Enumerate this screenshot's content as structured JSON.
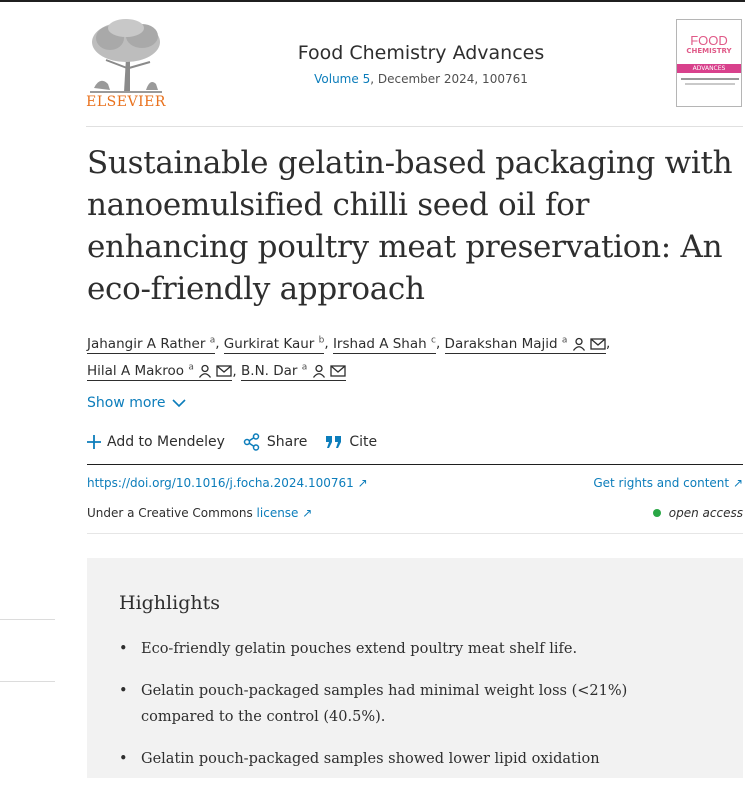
{
  "publisher": {
    "logo_text": "ELSEVIER"
  },
  "journal": {
    "name": "Food Chemistry Advances",
    "volume_link": "Volume 5",
    "issue_info": ", December 2024, 100761",
    "cover_line1": "FOOD",
    "cover_line2": "CHEMISTRY",
    "cover_band": "ADVANCES"
  },
  "article": {
    "title": "Sustainable gelatin-based packaging with nanoemulsified chilli seed oil for enhancing poultry meat preservation: An eco-friendly approach",
    "authors": [
      {
        "name": "Jahangir A Rather",
        "sup": "a",
        "icons": []
      },
      {
        "name": "Gurkirat Kaur",
        "sup": "b",
        "icons": []
      },
      {
        "name": "Irshad A Shah",
        "sup": "c",
        "icons": []
      },
      {
        "name": "Darakshan Majid",
        "sup": "a",
        "icons": [
          "person-icon",
          "mail-icon"
        ]
      },
      {
        "name": "Hilal A Makroo",
        "sup": "a",
        "icons": [
          "person-icon",
          "mail-icon"
        ]
      },
      {
        "name": "B.N. Dar",
        "sup": "a",
        "icons": [
          "person-icon",
          "mail-icon"
        ]
      }
    ],
    "show_more": "Show more",
    "actions": {
      "mendeley": "Add to Mendeley",
      "share": "Share",
      "cite": "Cite"
    },
    "doi": "https://doi.org/10.1016/j.focha.2024.100761",
    "rights": "Get rights and content",
    "license_prefix": "Under a Creative Commons ",
    "license_link": "license",
    "open_access": "open access"
  },
  "highlights": {
    "title": "Highlights",
    "items": [
      "Eco-friendly gelatin pouches extend poultry meat shelf life.",
      "Gelatin pouch-packaged samples had minimal weight loss (<21%) compared to the control (40.5%).",
      "Gelatin pouch-packaged samples showed lower lipid oxidation"
    ]
  },
  "colors": {
    "link": "#0c7dbb",
    "elsevier_orange": "#e9711c",
    "open_access_green": "#29a745",
    "highlight_bg": "#f2f2f2"
  }
}
